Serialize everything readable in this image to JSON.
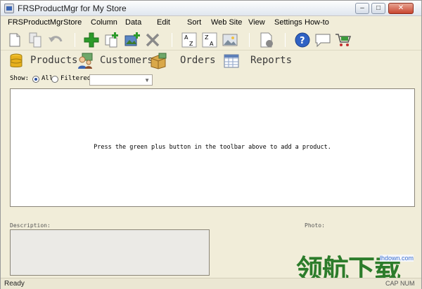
{
  "window": {
    "title": "FRSProductMgr for My Store",
    "controls": {
      "minimize": "–",
      "maximize": "□",
      "close": "✕"
    }
  },
  "menu": [
    "FRSProductMgr",
    "Store",
    "Column",
    "Data",
    "Edit",
    "Sort",
    "Web Site",
    "View",
    "Settings",
    "How-to"
  ],
  "toolbar": {
    "icons": [
      "new-icon",
      "copy-icon",
      "undo-icon",
      "add-icon",
      "duplicate-icon",
      "add-image-icon",
      "delete-icon",
      "sort-az-icon",
      "sort-za-icon",
      "image-icon",
      "upload-icon",
      "help-icon",
      "chat-icon",
      "cart-icon"
    ]
  },
  "tabs": [
    {
      "label": "Products",
      "icon": "database-icon"
    },
    {
      "label": "Customers",
      "icon": "customers-icon"
    },
    {
      "label": "Orders",
      "icon": "orders-icon"
    },
    {
      "label": "Reports",
      "icon": "reports-icon"
    }
  ],
  "filter": {
    "show_label": "Show:",
    "all_label": "All",
    "filtered_label": "Filtered",
    "selected": "All",
    "combo_value": ""
  },
  "grid": {
    "hint": "Press the green plus button in the toolbar above to add a product."
  },
  "description_label": "Description:",
  "photo_label": "Photo:",
  "status": {
    "text": "Ready",
    "indicators": [
      "CAP",
      "NUM"
    ]
  },
  "watermark": {
    "url": "lhdown.com",
    "logo": "领航下载"
  },
  "colors": {
    "background": "#f1edd9",
    "accent_green": "#2c9a2a",
    "help_blue": "#2f62c4"
  }
}
